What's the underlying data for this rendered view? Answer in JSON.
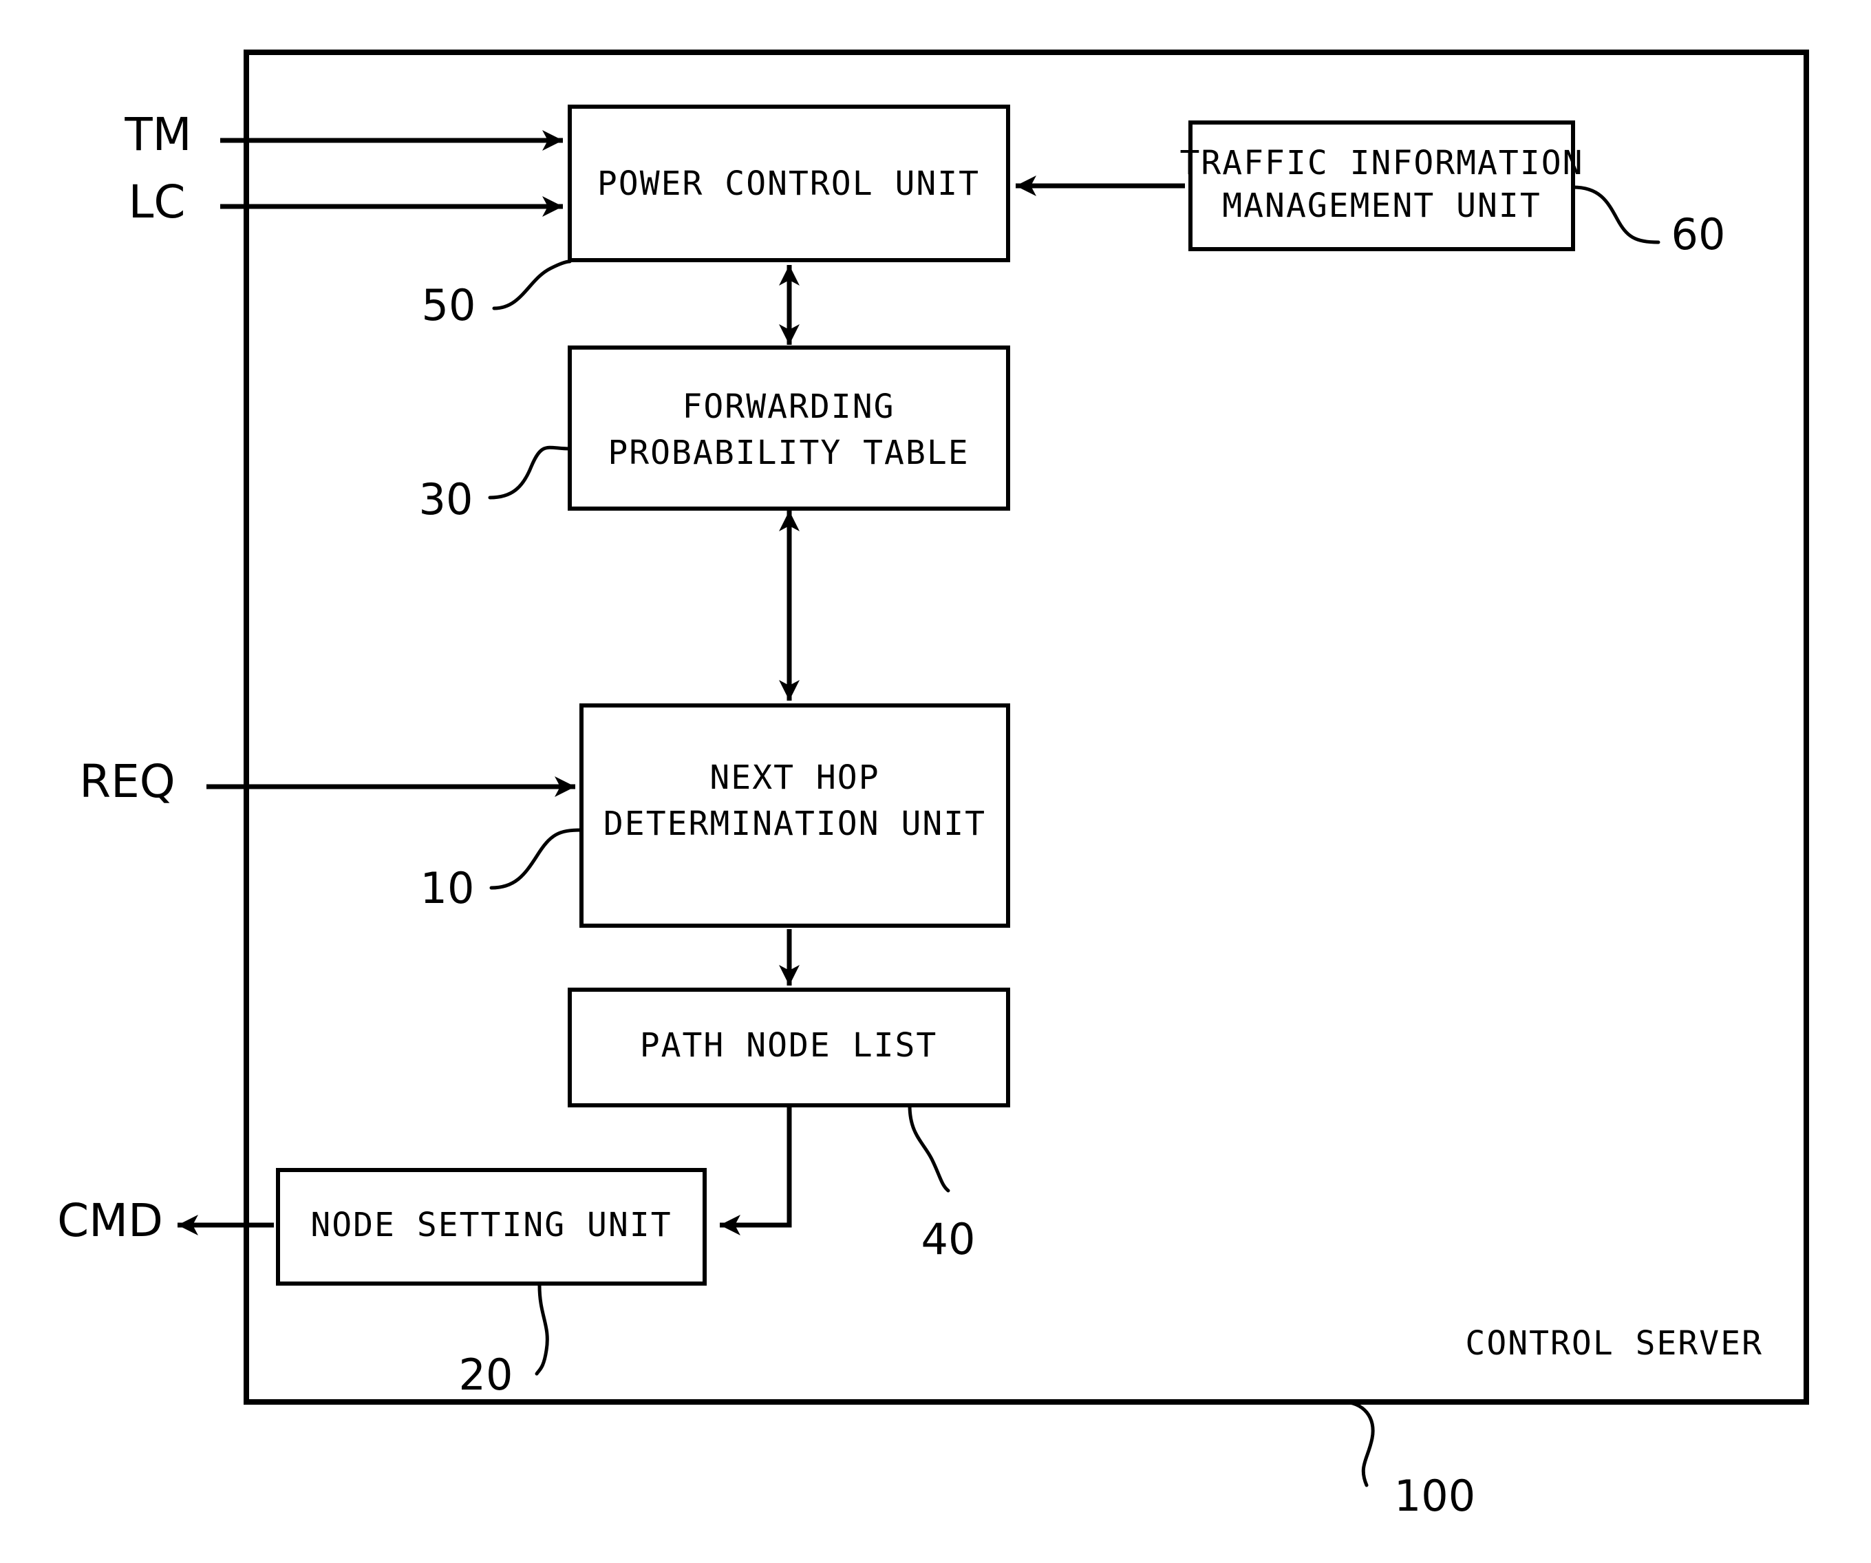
{
  "figure": {
    "frame_label": "CONTROL SERVER",
    "frame_ref": "100"
  },
  "boxes": [
    {
      "id": "power-control-unit",
      "lines": [
        "POWER CONTROL UNIT"
      ],
      "ref": "50"
    },
    {
      "id": "traffic-information-management-unit",
      "lines": [
        "TRAFFIC INFORMATION",
        "MANAGEMENT UNIT"
      ],
      "ref": "60"
    },
    {
      "id": "forwarding-probability-table",
      "lines": [
        "FORWARDING",
        "PROBABILITY TABLE"
      ],
      "ref": "30"
    },
    {
      "id": "next-hop-determination-unit",
      "lines": [
        "NEXT HOP",
        "DETERMINATION UNIT"
      ],
      "ref": "10"
    },
    {
      "id": "path-node-list",
      "lines": [
        "PATH NODE LIST"
      ],
      "ref": "40"
    },
    {
      "id": "node-setting-unit",
      "lines": [
        "NODE SETTING UNIT"
      ],
      "ref": "20"
    }
  ],
  "signals": {
    "tm": "TM",
    "lc": "LC",
    "req": "REQ",
    "cmd": "CMD"
  },
  "colors": {
    "ink": "#000000",
    "paper": "#ffffff"
  }
}
